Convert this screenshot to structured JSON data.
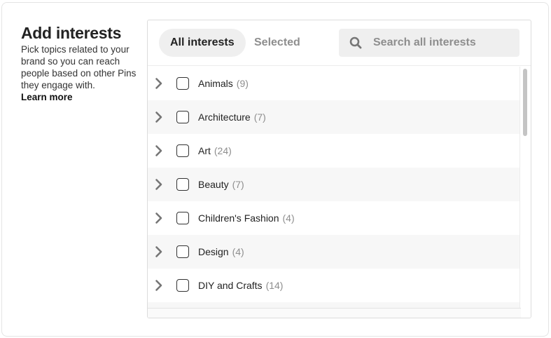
{
  "intro": {
    "title": "Add interests",
    "description": "Pick topics related to your brand so you can reach people based on other Pins they engage with.",
    "learn_more": "Learn more"
  },
  "tabs": {
    "all": "All interests",
    "selected": "Selected"
  },
  "search": {
    "placeholder": "Search all interests",
    "icon": "search-icon"
  },
  "interests": [
    {
      "label": "Animals",
      "count": "(9)"
    },
    {
      "label": "Architecture",
      "count": "(7)"
    },
    {
      "label": "Art",
      "count": "(24)"
    },
    {
      "label": "Beauty",
      "count": "(7)"
    },
    {
      "label": "Children's Fashion",
      "count": "(4)"
    },
    {
      "label": "Design",
      "count": "(4)"
    },
    {
      "label": "DIY and Crafts",
      "count": "(14)"
    }
  ],
  "colors": {
    "tab_active_bg": "#efefef",
    "muted_text": "#8e8e8e",
    "row_alt_bg": "#f7f7f7"
  }
}
